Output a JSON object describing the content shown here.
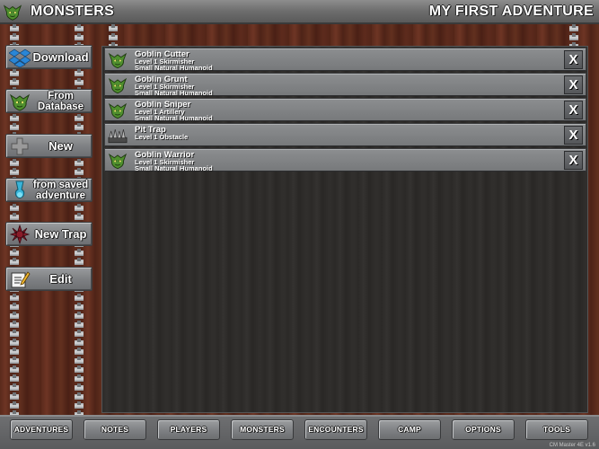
{
  "header": {
    "title": "MONSTERS",
    "adventure": "MY FIRST ADVENTURE",
    "logo_icon": "goblin-head-icon"
  },
  "sidebar": {
    "buttons": [
      {
        "label": "Download",
        "icon": "dropbox-icon"
      },
      {
        "label": "From Database",
        "icon": "goblin-head-icon"
      },
      {
        "label": "New",
        "icon": "plus-icon"
      },
      {
        "label": "from saved adventure",
        "icon": "potion-icon"
      },
      {
        "label": "New Trap",
        "icon": "trap-icon"
      },
      {
        "label": "Edit",
        "icon": "edit-icon"
      }
    ]
  },
  "list": {
    "items": [
      {
        "name": "Goblin Cutter",
        "line1": "Level 1 Skirmisher",
        "line2": "Small Natural Humanoid",
        "icon": "goblin-head-icon",
        "remove": "X"
      },
      {
        "name": "Goblin Grunt",
        "line1": "Level 1 Skirmisher",
        "line2": "Small Natural Humanoid",
        "icon": "goblin-head-icon",
        "remove": "X"
      },
      {
        "name": "Goblin Sniper",
        "line1": "Level 1 Artillery",
        "line2": "Small Natural Humanoid",
        "icon": "goblin-head-icon",
        "remove": "X"
      },
      {
        "name": "Pit Trap",
        "line1": "Level 1 Obstacle",
        "line2": "",
        "icon": "spike-trap-icon",
        "remove": "X"
      },
      {
        "name": "Goblin Warrior",
        "line1": "Level 1 Skirmisher",
        "line2": "Small Natural Humanoid",
        "icon": "goblin-head-icon",
        "remove": "X"
      }
    ]
  },
  "bottom_tabs": [
    "ADVENTURES",
    "NOTES",
    "PLAYERS",
    "MONSTERS",
    "ENCOUNTERS",
    "CAMP",
    "OPTIONS",
    "TOOLS"
  ],
  "version": "CM Master 4E v1.6",
  "colors": {
    "goblin": "#4f8f2e",
    "wood": "#5a2a1c",
    "panel": "#7f8184"
  }
}
